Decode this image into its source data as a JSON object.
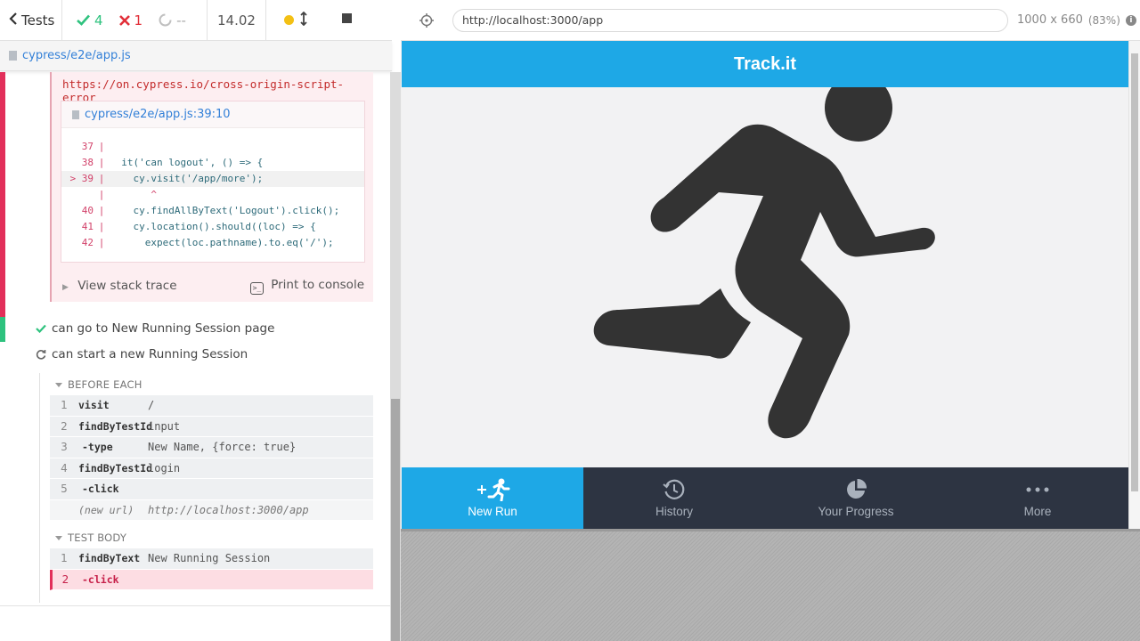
{
  "topbar": {
    "tests_label": "Tests",
    "passed": "4",
    "failed": "1",
    "pending": "--",
    "duration": "14.02"
  },
  "spec": {
    "file": "cypress/e2e/app.js"
  },
  "error": {
    "url": "https://on.cypress.io/cross-origin-script-error",
    "frame_location": "cypress/e2e/app.js:39:10",
    "code_lines": [
      {
        "ln": "37",
        "code": ""
      },
      {
        "ln": "38",
        "code": "  it('can logout', () => {"
      },
      {
        "ln": "> 39",
        "code": "    cy.visit('/app/more');"
      },
      {
        "ln": "",
        "code": "       ^"
      },
      {
        "ln": "40",
        "code": "    cy.findAllByText('Logout').click();"
      },
      {
        "ln": "41",
        "code": "    cy.location().should((loc) => {"
      },
      {
        "ln": "42",
        "code": "      expect(loc.pathname).to.eq('/');"
      }
    ],
    "view_stack": "View stack trace",
    "print_console": "Print to console"
  },
  "tests": [
    {
      "title": "can go to New Running Session page",
      "state": "passed"
    },
    {
      "title": "can start a new Running Session",
      "state": "running"
    }
  ],
  "before_each": {
    "label": "BEFORE EACH",
    "commands": [
      {
        "num": "1",
        "name": "visit",
        "msg": "/"
      },
      {
        "num": "2",
        "name": "findByTestId",
        "msg": "input"
      },
      {
        "num": "3",
        "name": "-type",
        "msg": "New Name, {force: true}"
      },
      {
        "num": "4",
        "name": "findByTestId",
        "msg": "login"
      },
      {
        "num": "5",
        "name": "-click",
        "msg": ""
      },
      {
        "num": "",
        "name": "(new url)",
        "msg": "http://localhost:3000/app"
      }
    ]
  },
  "test_body": {
    "label": "TEST BODY",
    "commands": [
      {
        "num": "1",
        "name": "findByText",
        "msg": "New Running Session"
      },
      {
        "num": "2",
        "name": "-click",
        "msg": ""
      }
    ]
  },
  "aut": {
    "url": "http://localhost:3000/app",
    "viewport": "1000 x 660",
    "scale": "(83%)",
    "app_title": "Track.it",
    "nav": [
      {
        "label": "New Run",
        "icon": "run-plus-icon",
        "active": true
      },
      {
        "label": "History",
        "icon": "history-clock-icon",
        "active": false
      },
      {
        "label": "Your Progress",
        "icon": "pie-chart-icon",
        "active": false
      },
      {
        "label": "More",
        "icon": "more-dots-icon",
        "active": false
      }
    ]
  },
  "colors": {
    "accent": "#1ea8e6",
    "nav_bg": "#2d3442",
    "pass": "#2ec27e",
    "fail": "#e22f39"
  }
}
